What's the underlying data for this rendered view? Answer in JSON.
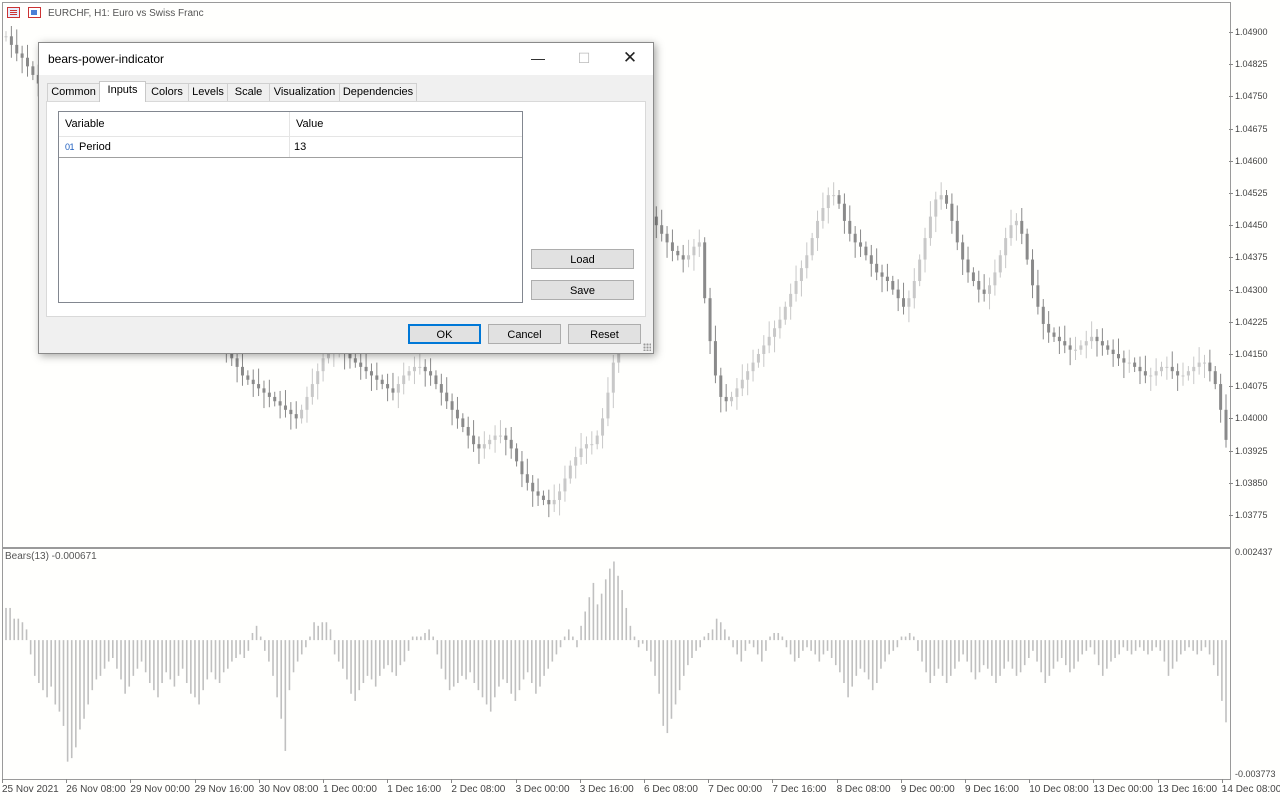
{
  "chart": {
    "symbol_title": "EURCHF, H1:  Euro vs Swiss Franc",
    "indicator_label": "Bears(13) -0.000671",
    "price_axis": [
      "1.04900",
      "1.04825",
      "1.04750",
      "1.04675",
      "1.04600",
      "1.04525",
      "1.04450",
      "1.04375",
      "1.04300",
      "1.04225",
      "1.04150",
      "1.04075",
      "1.04000",
      "1.03925",
      "1.03850",
      "1.03775"
    ],
    "indicator_axis": {
      "top": "0.002437",
      "bottom": "-0.003773"
    },
    "time_axis": [
      "25 Nov 2021",
      "26 Nov 08:00",
      "29 Nov 00:00",
      "29 Nov 16:00",
      "30 Nov 08:00",
      "1 Dec 00:00",
      "1 Dec 16:00",
      "2 Dec 08:00",
      "3 Dec 00:00",
      "3 Dec 16:00",
      "6 Dec 08:00",
      "7 Dec 00:00",
      "7 Dec 16:00",
      "8 Dec 08:00",
      "9 Dec 00:00",
      "9 Dec 16:00",
      "10 Dec 08:00",
      "13 Dec 00:00",
      "13 Dec 16:00",
      "14 Dec 08:00"
    ]
  },
  "chart_data": [
    {
      "type": "candlestick",
      "title": "EURCHF, H1:  Euro vs Swiss Franc",
      "ylim": [
        1.0374,
        1.0493
      ],
      "close_series": [
        1.0489,
        1.0487,
        1.0485,
        1.0484,
        1.0482,
        1.048,
        1.0478,
        1.0475,
        1.0472,
        1.047,
        1.0468,
        1.0466,
        1.0464,
        1.0462,
        1.046,
        1.0458,
        1.0456,
        1.0455,
        1.0454,
        1.0452,
        1.045,
        1.0449,
        1.0448,
        1.0446,
        1.0445,
        1.0444,
        1.0442,
        1.0441,
        1.044,
        1.0439,
        1.0437,
        1.0436,
        1.0434,
        1.0432,
        1.043,
        1.0428,
        1.0426,
        1.0424,
        1.0422,
        1.042,
        1.0418,
        1.0416,
        1.0414,
        1.0412,
        1.041,
        1.0409,
        1.0408,
        1.0407,
        1.0406,
        1.0405,
        1.0404,
        1.0403,
        1.0402,
        1.0401,
        1.04,
        1.0402,
        1.0405,
        1.0408,
        1.0411,
        1.0414,
        1.0415,
        1.0416,
        1.0416,
        1.0415,
        1.0414,
        1.0413,
        1.0412,
        1.0411,
        1.041,
        1.0409,
        1.0408,
        1.0407,
        1.0406,
        1.0408,
        1.041,
        1.0411,
        1.0412,
        1.0412,
        1.0411,
        1.041,
        1.0408,
        1.0406,
        1.0404,
        1.0402,
        1.04,
        1.0398,
        1.0396,
        1.0394,
        1.0393,
        1.0394,
        1.0395,
        1.0396,
        1.0396,
        1.0395,
        1.0393,
        1.039,
        1.0387,
        1.0385,
        1.0383,
        1.0382,
        1.0381,
        1.038,
        1.0381,
        1.0383,
        1.0386,
        1.0389,
        1.0391,
        1.0393,
        1.0394,
        1.0394,
        1.0396,
        1.04,
        1.0406,
        1.0413,
        1.042,
        1.0428,
        1.0436,
        1.0443,
        1.0447,
        1.0448,
        1.0447,
        1.0445,
        1.0443,
        1.0441,
        1.0439,
        1.0438,
        1.0437,
        1.0438,
        1.044,
        1.0441,
        1.0428,
        1.0418,
        1.041,
        1.0405,
        1.0404,
        1.0405,
        1.0407,
        1.0409,
        1.0411,
        1.0413,
        1.0415,
        1.0417,
        1.0419,
        1.0421,
        1.0423,
        1.0426,
        1.0429,
        1.0432,
        1.0435,
        1.0438,
        1.0442,
        1.0446,
        1.0449,
        1.0452,
        1.0452,
        1.045,
        1.0446,
        1.0443,
        1.0441,
        1.044,
        1.0438,
        1.0436,
        1.0434,
        1.0433,
        1.0432,
        1.043,
        1.0428,
        1.0426,
        1.0428,
        1.0432,
        1.0437,
        1.0442,
        1.0447,
        1.0451,
        1.0452,
        1.045,
        1.0446,
        1.0441,
        1.0437,
        1.0434,
        1.0432,
        1.043,
        1.0429,
        1.0431,
        1.0434,
        1.0438,
        1.0442,
        1.0445,
        1.0446,
        1.0443,
        1.0437,
        1.0431,
        1.0426,
        1.0422,
        1.042,
        1.0419,
        1.0418,
        1.0417,
        1.0416,
        1.0416,
        1.0417,
        1.0418,
        1.0419,
        1.0418,
        1.0417,
        1.0416,
        1.0415,
        1.0414,
        1.0413,
        1.0413,
        1.0412,
        1.0411,
        1.041,
        1.041,
        1.0411,
        1.0412,
        1.0412,
        1.0411,
        1.041,
        1.041,
        1.0411,
        1.0412,
        1.0413,
        1.0413,
        1.0411,
        1.0408,
        1.0402,
        1.0395
      ]
    },
    {
      "type": "bar",
      "title": "Bears(13) -0.000671",
      "ylim": [
        -0.003773,
        0.002437
      ],
      "values": [
        0.0009,
        0.0009,
        0.0006,
        0.0006,
        0.0005,
        0.0003,
        -0.0004,
        -0.001,
        -0.0012,
        -0.0014,
        -0.0016,
        -0.0013,
        -0.0018,
        -0.002,
        -0.0024,
        -0.0034,
        -0.0033,
        -0.003,
        -0.0025,
        -0.0022,
        -0.0018,
        -0.0014,
        -0.0011,
        -0.001,
        -0.0008,
        -0.0006,
        -0.0005,
        -0.0008,
        -0.0011,
        -0.0015,
        -0.0013,
        -0.001,
        -0.0008,
        -0.0006,
        -0.0009,
        -0.0012,
        -0.0014,
        -0.0016,
        -0.0012,
        -0.0009,
        -0.0011,
        -0.0013,
        -0.001,
        -0.0008,
        -0.0012,
        -0.0015,
        -0.0016,
        -0.0018,
        -0.0014,
        -0.0011,
        -0.0009,
        -0.0011,
        -0.0012,
        -0.0009,
        -0.0008,
        -0.0006,
        -0.0005,
        -0.0004,
        -0.0005,
        -0.0003,
        0.0002,
        0.0004,
        0.0001,
        -0.0003,
        -0.0006,
        -0.001,
        -0.0016,
        -0.0022,
        -0.0031,
        -0.0014,
        -0.0009,
        -0.0006,
        -0.0004,
        -0.0002,
        0.0001,
        0.0005,
        0.0004,
        0.0005,
        0.0005,
        0.0003,
        -0.0004,
        -0.0006,
        -0.0008,
        -0.0011,
        -0.0015,
        -0.0017,
        -0.0014,
        -0.0012,
        -0.001,
        -0.0011,
        -0.0013,
        -0.001,
        -0.0008,
        -0.0007,
        -0.0009,
        -0.001,
        -0.0007,
        -0.0006,
        -0.0003,
        0.0001,
        0.0001,
        0.0001,
        0.0002,
        0.0003,
        0.0001,
        -0.0004,
        -0.0008,
        -0.0011,
        -0.0014,
        -0.0013,
        -0.0012,
        -0.001,
        -0.0011,
        -0.0009,
        -0.0012,
        -0.0014,
        -0.0016,
        -0.0018,
        -0.002,
        -0.0016,
        -0.0013,
        -0.0011,
        -0.0012,
        -0.0015,
        -0.0017,
        -0.0014,
        -0.0011,
        -0.0009,
        -0.0012,
        -0.0015,
        -0.0013,
        -0.001,
        -0.0008,
        -0.0006,
        -0.0004,
        -0.0002,
        0.0001,
        0.0003,
        0.0001,
        -0.0002,
        0.0004,
        0.0008,
        0.0012,
        0.0016,
        0.001,
        0.0013,
        0.0017,
        0.002,
        0.0022,
        0.0018,
        0.0014,
        0.0009,
        0.0004,
        0.0001,
        -0.0002,
        -0.0001,
        -0.0003,
        -0.0006,
        -0.001,
        -0.0015,
        -0.0024,
        -0.0026,
        -0.0022,
        -0.0018,
        -0.0014,
        -0.001,
        -0.0007,
        -0.0005,
        -0.0003,
        -0.0002,
        0.0001,
        0.0002,
        0.0003,
        0.0006,
        0.0005,
        0.0003,
        0.0001,
        -0.0002,
        -0.0004,
        -0.0006,
        -0.0003,
        -0.0001,
        -0.0002,
        -0.0004,
        -0.0006,
        -0.0003,
        0.0001,
        0.0002,
        0.0002,
        0.0001,
        -0.0002,
        -0.0004,
        -0.0006,
        -0.0005,
        -0.0003,
        -0.0002,
        -0.0003,
        -0.0004,
        -0.0006,
        -0.0004,
        -0.0003,
        -0.0005,
        -0.0007,
        -0.0009,
        -0.0012,
        -0.0016,
        -0.0013,
        -0.001,
        -0.0008,
        -0.0009,
        -0.0011,
        -0.0014,
        -0.0012,
        -0.0008,
        -0.0006,
        -0.0004,
        -0.0003,
        -0.0002,
        0.0001,
        0.0001,
        0.0002,
        0.0001,
        -0.0003,
        -0.0006,
        -0.0009,
        -0.0012,
        -0.001,
        -0.0008,
        -0.001,
        -0.0012,
        -0.001,
        -0.0008,
        -0.0006,
        -0.0004,
        -0.0006,
        -0.0009,
        -0.0011,
        -0.0009,
        -0.0007,
        -0.0008,
        -0.001,
        -0.0012,
        -0.001,
        -0.0008,
        -0.0006,
        -0.0008,
        -0.001,
        -0.0009,
        -0.0007,
        -0.0005,
        -0.0003,
        -0.0006,
        -0.0009,
        -0.0012,
        -0.001,
        -0.0008,
        -0.0006,
        -0.0005,
        -0.0007,
        -0.0009,
        -0.0008,
        -0.0006,
        -0.0004,
        -0.0003,
        -0.0002,
        -0.0004,
        -0.0007,
        -0.001,
        -0.0008,
        -0.0006,
        -0.0005,
        -0.0004,
        -0.0002,
        -0.0003,
        -0.0004,
        -0.0003,
        -0.0002,
        -0.0003,
        -0.0004,
        -0.0003,
        -0.0002,
        -0.0003,
        -0.0006,
        -0.001,
        -0.0008,
        -0.0006,
        -0.0004,
        -0.0003,
        -0.0002,
        -0.0003,
        -0.0004,
        -0.0003,
        -0.0002,
        -0.0004,
        -0.0007,
        -0.001,
        -0.0017,
        -0.0023
      ]
    }
  ],
  "dialog": {
    "title": "bears-power-indicator",
    "min_glyph": "—",
    "max_glyph": "☐",
    "close_glyph": "✕",
    "tabs": [
      "Common",
      "Inputs",
      "Colors",
      "Levels",
      "Scale",
      "Visualization",
      "Dependencies"
    ],
    "active_tab": "Inputs",
    "grid": {
      "col_variable": "Variable",
      "col_value": "Value",
      "rows": [
        {
          "type_icon": "01",
          "variable": "Period",
          "value": "13"
        }
      ]
    },
    "buttons": {
      "load": "Load",
      "save": "Save",
      "ok": "OK",
      "cancel": "Cancel",
      "reset": "Reset"
    }
  },
  "colors": {
    "bull_candle": "#c8c8c8",
    "bear_candle": "#8a8a8a",
    "histogram": "#c0c0c0",
    "dialog_accent": "#0078d7"
  }
}
